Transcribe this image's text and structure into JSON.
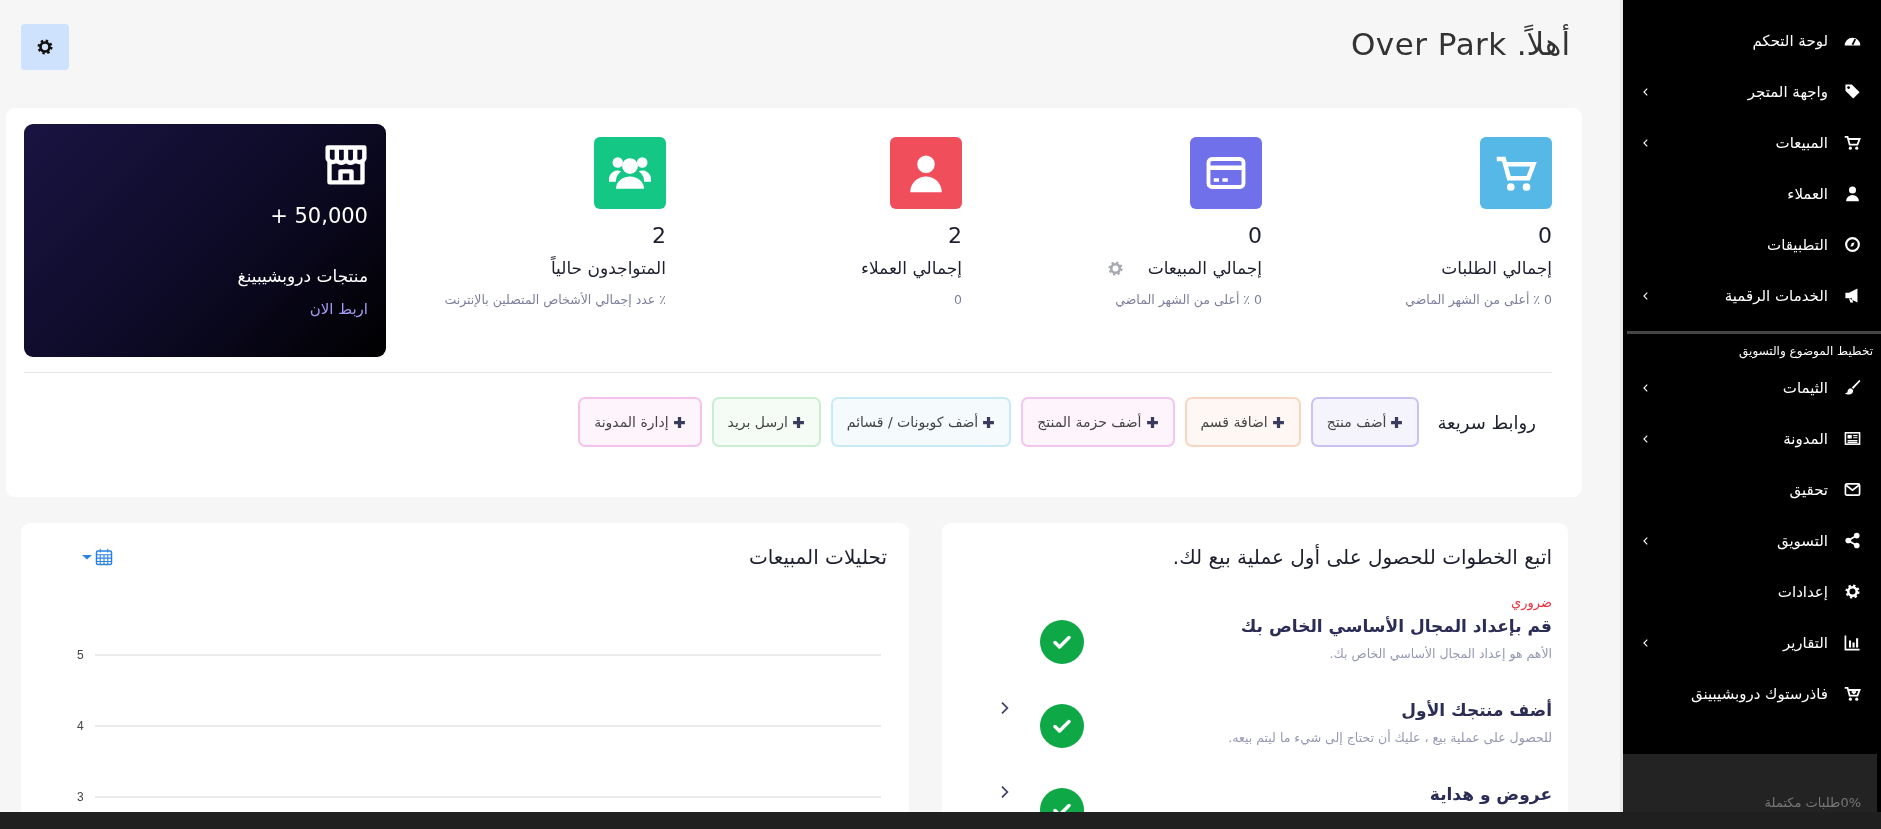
{
  "header": {
    "title": "أهلاً. Over Park",
    "settings_button": {
      "kind": "gear"
    }
  },
  "stats": [
    {
      "kind": "orders",
      "color": "#56b8e6",
      "value": "0",
      "label": "إجمالي الطلبات",
      "note": "0 ٪ أعلى من الشهر الماضي",
      "gear": false
    },
    {
      "kind": "sales",
      "color": "#7070ea",
      "value": "0",
      "label": "إجمالي المبيعات",
      "note": "0 ٪ أعلى من الشهر الماضي",
      "gear": true
    },
    {
      "kind": "customers",
      "color": "#f04e5b",
      "value": "2",
      "label": "إجمالي العملاء",
      "note": "0",
      "gear": false
    },
    {
      "kind": "online",
      "color": "#14c784",
      "value": "2",
      "label": "المتواجدون حالياً",
      "note": "٪ عدد إجمالي الأشخاص المتصلين بالإنترنت",
      "gear": false
    }
  ],
  "promo": {
    "value": "+ 50,000",
    "label": "منتجات دروبشيبينغ",
    "link": "اربط الان"
  },
  "quick_links": {
    "title": "روابط سريعة",
    "links": [
      {
        "label": "أضف منتج",
        "color": "#c9c3f3"
      },
      {
        "label": "اضافة قسم",
        "color": "#f8d6c0"
      },
      {
        "label": "أضف حزمة المنتج",
        "color": "#f3c6ef"
      },
      {
        "label": "أضف كوبونات / قسائم",
        "color": "#c8e9f6"
      },
      {
        "label": "ارسل بريد",
        "color": "#c9efcf"
      },
      {
        "label": "إدارة المدونة",
        "color": "#f4c4ee"
      }
    ]
  },
  "steps_card": {
    "title": "اتبع الخطوات للحصول على أول عملية بيع لك.",
    "required_label": "ضروري",
    "steps": [
      {
        "title": "قم بإعداد المجال الأساسي الخاص بك",
        "desc": "الأهم هو إعداد المجال الأساسي الخاص بك.",
        "done": true,
        "arrow": false
      },
      {
        "title": "أضف منتجك الأول",
        "desc": "للحصول على عملية بيع ، عليك أن تحتاج إلى شيء ما ليتم بيعه.",
        "done": true,
        "arrow": true
      },
      {
        "title": "عروض و هداية",
        "done": true,
        "arrow": true
      }
    ]
  },
  "analytics": {
    "title": "تحليلات المبيعات",
    "axis_labels": [
      "5",
      "4",
      "3"
    ]
  },
  "sidebar": {
    "items": [
      {
        "label": "لوحة التحكم",
        "kind": "gauge",
        "has_children": false
      },
      {
        "label": "واجهة المتجر",
        "kind": "tag",
        "has_children": true
      },
      {
        "label": "المبيعات",
        "kind": "cart",
        "has_children": true
      },
      {
        "label": "العملاء",
        "kind": "user",
        "has_children": false
      },
      {
        "label": "التطبيقات",
        "kind": "compass",
        "has_children": false
      },
      {
        "label": "الخدمات الرقمية",
        "kind": "megaphone",
        "has_children": true
      }
    ],
    "section_label": "تخطيط الموضوع والتسويق",
    "section_items": [
      {
        "label": "الثيمات",
        "kind": "brush",
        "has_children": true
      },
      {
        "label": "المدونة",
        "kind": "newspaper",
        "has_children": true
      },
      {
        "label": "تحقيق",
        "kind": "envelope",
        "has_children": false
      },
      {
        "label": "التسويق",
        "kind": "share",
        "has_children": true
      },
      {
        "label": "إعدادات",
        "kind": "gear",
        "has_children": false
      },
      {
        "label": "التقارير",
        "kind": "barchart",
        "has_children": true
      },
      {
        "label": "فاذرستوك دروبشيبينق",
        "kind": "cartdown",
        "has_children": false
      }
    ],
    "progress": {
      "percent": "0%",
      "label": "طلبات مكتملة"
    }
  }
}
